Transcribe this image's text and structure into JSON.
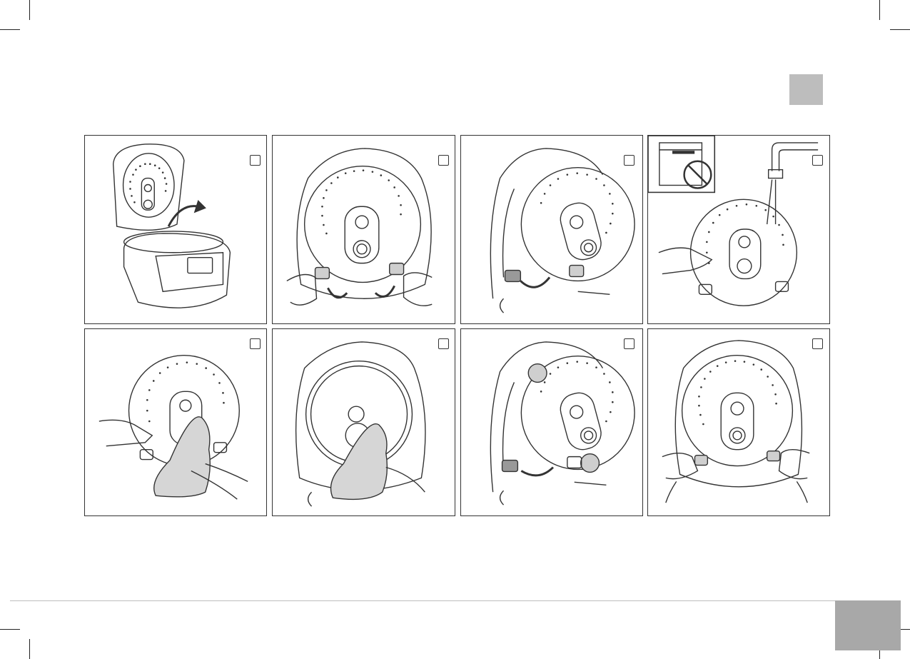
{
  "page": {
    "tab_marker_color": "#bdbdbd",
    "page_tab_color": "#a8a8a8",
    "line_color": "#333333",
    "highlight_color": "#cfcfcf"
  },
  "figures": [
    {
      "id": "fig-1",
      "icon": "open-cooker-lid-arrow"
    },
    {
      "id": "fig-2",
      "icon": "inner-lid-release-tabs"
    },
    {
      "id": "fig-3",
      "icon": "inner-lid-removal"
    },
    {
      "id": "fig-4",
      "icon": "no-dishwasher-rinse-under-tap"
    },
    {
      "id": "fig-5",
      "icon": "wipe-inner-lid-cloth"
    },
    {
      "id": "fig-6",
      "icon": "wipe-lid-cloth"
    },
    {
      "id": "fig-7",
      "icon": "inner-lid-refit"
    },
    {
      "id": "fig-8",
      "icon": "inner-lid-clip-tabs"
    }
  ]
}
